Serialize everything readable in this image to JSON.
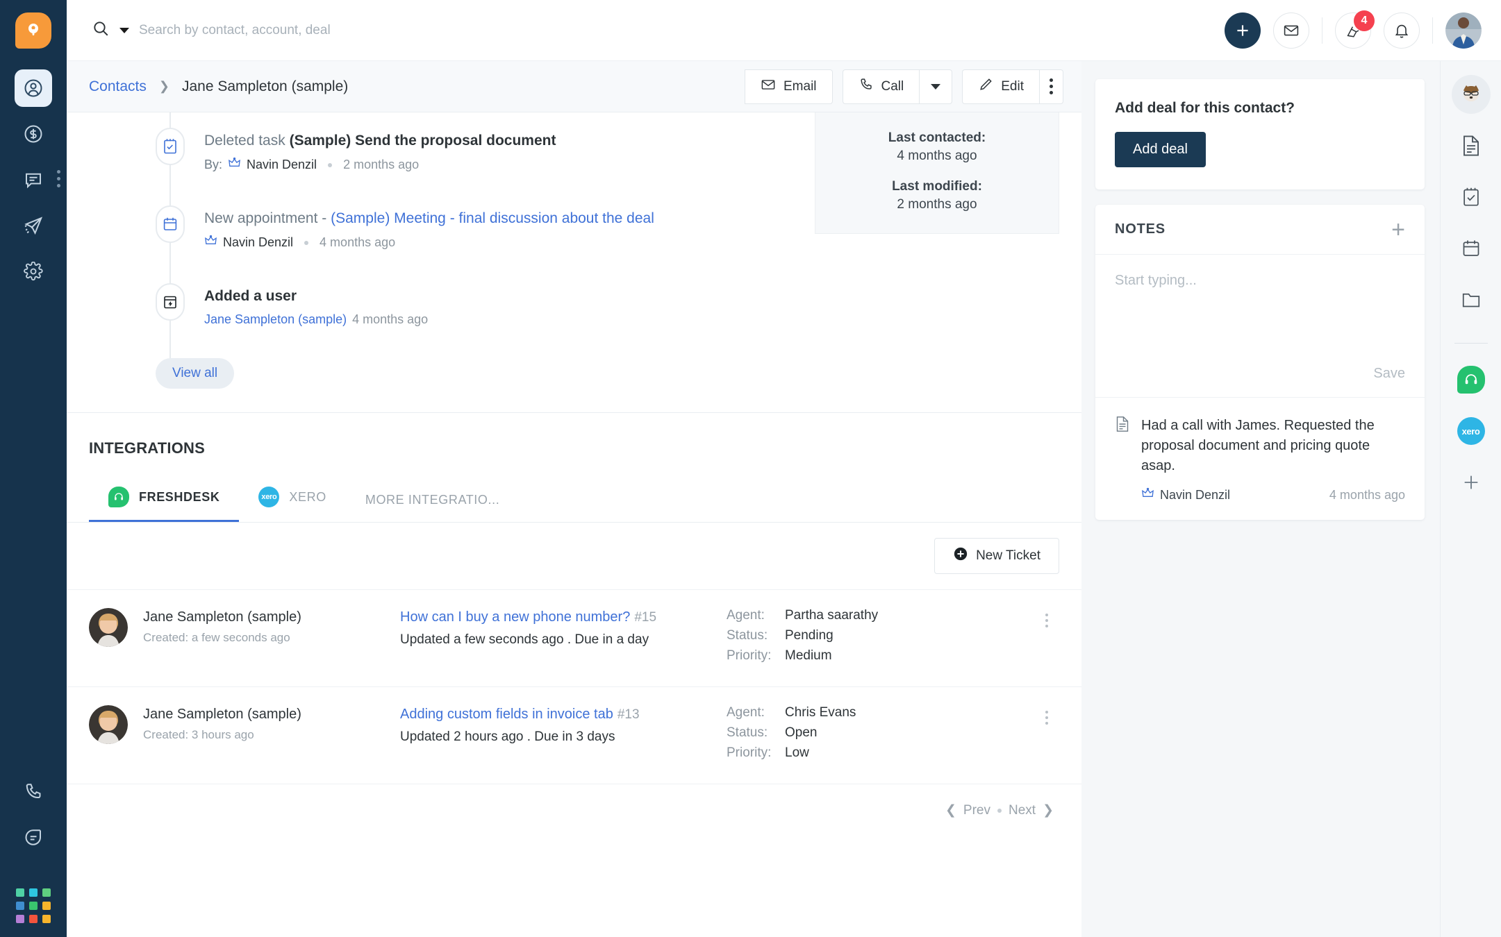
{
  "leftnav": {
    "logo": "freshworks-logo-icon",
    "items": [
      {
        "name": "contacts",
        "icon": "person-circle-icon",
        "active": true
      },
      {
        "name": "deals",
        "icon": "dollar-circle-icon",
        "active": false
      },
      {
        "name": "conversations",
        "icon": "chat-bubble-icon",
        "active": false
      },
      {
        "name": "campaigns",
        "icon": "paper-plane-icon",
        "active": false
      },
      {
        "name": "settings",
        "icon": "gear-icon",
        "active": false
      }
    ],
    "bottom_items": [
      {
        "name": "phone",
        "icon": "phone-icon"
      },
      {
        "name": "chat",
        "icon": "speech-bubble-icon"
      }
    ],
    "app_grid_colors": [
      "#4fd1a5",
      "#2ec6e0",
      "#5fcf80",
      "#3f8ed0",
      "#39c46e",
      "#f7b52c",
      "#b57fd6",
      "#f2543d",
      "#f7b52c"
    ]
  },
  "topbar": {
    "search_placeholder": "Search by contact, account, deal",
    "search_value": "",
    "add_label": "+",
    "notifications_badge": "4"
  },
  "header": {
    "breadcrumb_root": "Contacts",
    "breadcrumb_current": "Jane Sampleton (sample)",
    "email_label": "Email",
    "call_label": "Call",
    "edit_label": "Edit"
  },
  "timeline": {
    "entries": [
      {
        "icon": "task-checklist-icon",
        "action": "Deleted task",
        "subject": "(Sample) Send the proposal document",
        "subject_style": "bold",
        "meta_label": "By:",
        "author": "Navin Denzil",
        "time": "2 months ago"
      },
      {
        "icon": "calendar-icon",
        "action": "New appointment",
        "dash": "-",
        "subject": "(Sample) Meeting - final discussion about the deal",
        "subject_style": "link",
        "meta_label": "",
        "author": "Navin Denzil",
        "time": "4 months ago"
      },
      {
        "icon": "bolt-box-icon",
        "action": "Added a user",
        "subject": "",
        "subject_style": "none",
        "meta_label": "",
        "author": "Jane Sampleton (sample)",
        "author_style": "link",
        "time": "4 months ago"
      }
    ],
    "view_all_label": "View all"
  },
  "infocard": {
    "last_contacted_label": "Last contacted:",
    "last_contacted_value": "4 months ago",
    "last_modified_label": "Last modified:",
    "last_modified_value": "2 months ago"
  },
  "integrations": {
    "title": "INTEGRATIONS",
    "tabs": [
      {
        "label": "FRESHDESK",
        "icon": "freshdesk-icon",
        "active": true
      },
      {
        "label": "XERO",
        "icon": "xero-icon",
        "active": false
      },
      {
        "label": "MORE INTEGRATIO...",
        "icon": "none",
        "active": false
      }
    ],
    "new_ticket_label": "New Ticket",
    "field_labels": {
      "agent": "Agent:",
      "status": "Status:",
      "priority": "Priority:"
    },
    "tickets": [
      {
        "contact": "Jane Sampleton (sample)",
        "created": "Created: a few seconds ago",
        "subject": "How can I buy a new phone number?",
        "number": "#15",
        "updated": "Updated a few seconds ago . Due in a day",
        "agent": "Partha saarathy",
        "status": "Pending",
        "priority": "Medium"
      },
      {
        "contact": "Jane Sampleton (sample)",
        "created": "Created: 3 hours ago",
        "subject": "Adding custom fields in invoice tab",
        "number": "#13",
        "updated": "Updated 2 hours ago . Due in 3 days",
        "agent": "Chris Evans",
        "status": "Open",
        "priority": "Low"
      }
    ],
    "pager": {
      "prev": "Prev",
      "next": "Next"
    }
  },
  "rightpane": {
    "add_deal_question": "Add deal for this contact?",
    "add_deal_button": "Add deal",
    "notes_title": "NOTES",
    "notes_placeholder": "Start typing...",
    "notes_value": "",
    "notes_save_label": "Save",
    "notes": [
      {
        "text": "Had a call with James. Requested the proposal document and pricing quote asap.",
        "author": "Navin Denzil",
        "time": "4 months ago"
      }
    ]
  },
  "rightrail": {
    "items": [
      {
        "name": "contact-avatar",
        "icon": "dog-avatar-icon",
        "active": true
      },
      {
        "name": "notes",
        "icon": "document-icon",
        "active": false
      },
      {
        "name": "tasks",
        "icon": "task-checklist-icon",
        "active": false
      },
      {
        "name": "appointments",
        "icon": "calendar-icon",
        "active": false
      },
      {
        "name": "files",
        "icon": "folder-icon",
        "active": false
      }
    ],
    "integration_items": [
      {
        "name": "freshdesk",
        "icon": "freshdesk-icon"
      },
      {
        "name": "xero",
        "icon": "xero-icon"
      }
    ],
    "add_label": "+"
  },
  "colors": {
    "nav_bg": "#16334c",
    "accent_blue": "#3f71d7",
    "brand_orange": "#f79a3a",
    "freshdesk_green": "#25c16f",
    "xero_blue": "#2eb5e5",
    "badge_red": "#f5414f"
  }
}
